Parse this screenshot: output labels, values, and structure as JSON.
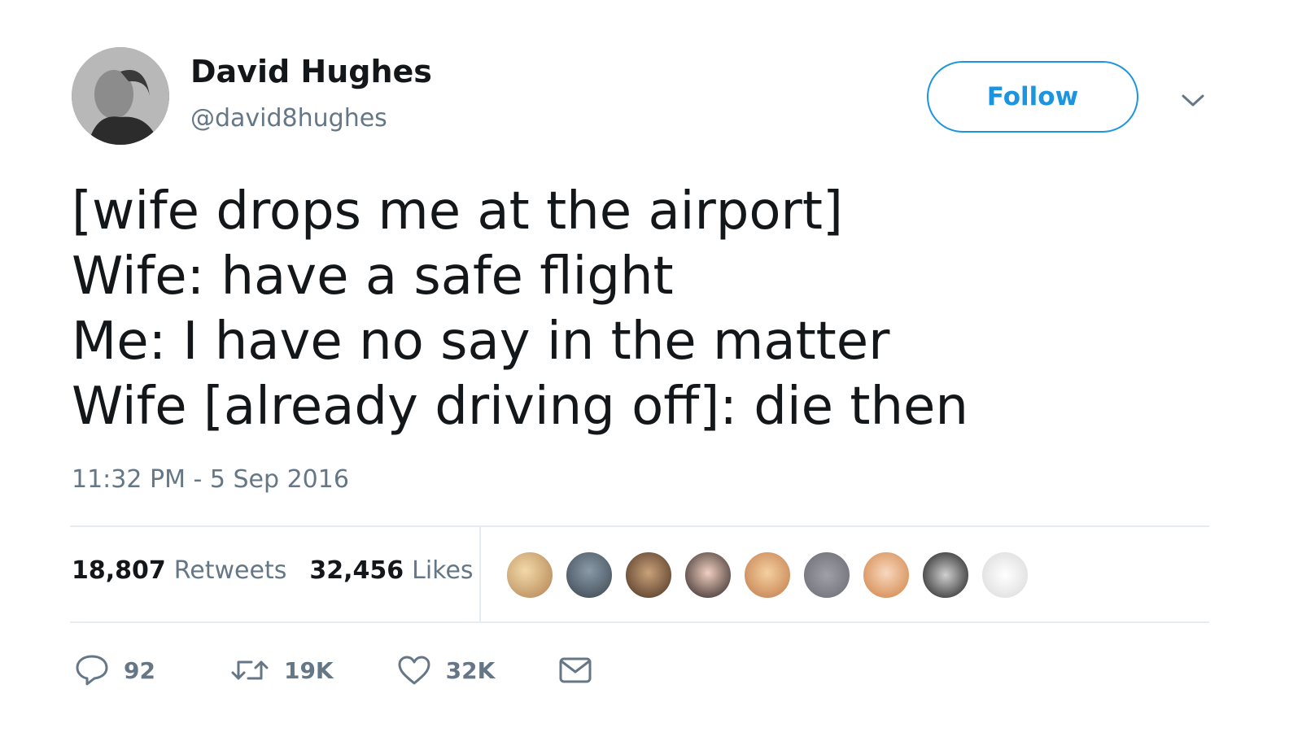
{
  "author": {
    "name": "David Hughes",
    "handle": "@david8hughes",
    "avatar_icon": "profile-photo"
  },
  "follow_label": "Follow",
  "tweet": {
    "lines": [
      "[wife drops me at the airport]",
      "Wife: have a safe flight",
      "Me: I have no say in the matter",
      "Wife [already driving off]: die then"
    ],
    "timestamp": "11:32 PM - 5 Sep 2016"
  },
  "stats": {
    "retweets_count": "18,807",
    "retweets_label": "Retweets",
    "likes_count": "32,456",
    "likes_label": "Likes"
  },
  "likers_count": 9,
  "actions": {
    "reply_count": "92",
    "retweet_count": "19K",
    "like_count": "32K"
  },
  "colors": {
    "accent": "#1b95e0",
    "text": "#14171a",
    "secondary": "#657786",
    "divider": "#e6ecf0"
  }
}
